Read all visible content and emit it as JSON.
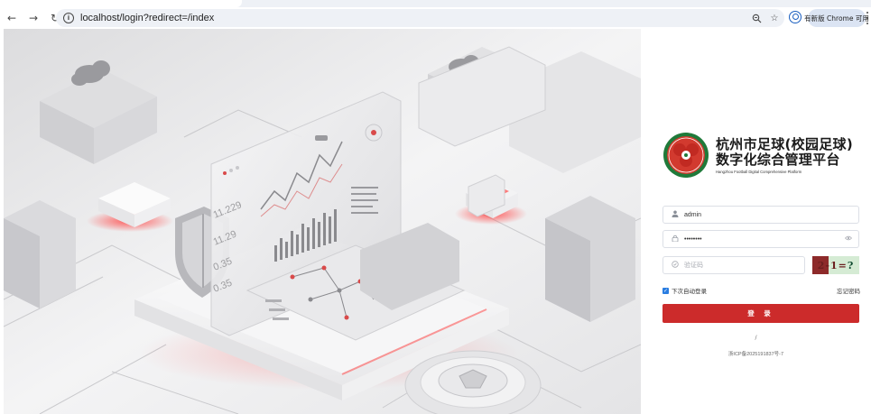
{
  "browser": {
    "url": "localhost/login?redirect=/index",
    "update_label": "有新版 Chrome 可用"
  },
  "brand": {
    "title_line1": "杭州市足球(校园足球)",
    "title_line2": "数字化综合管理平台",
    "subtitle": "Hangzhou Football Digital Comprehensive Platform",
    "accent_color": "#cc2b2b"
  },
  "hero": {
    "panel_values": [
      "11.229",
      "11.29",
      "0.35",
      "0.35"
    ]
  },
  "login": {
    "username_value": "admin",
    "password_value": "••••••••",
    "captcha_placeholder": "验证码",
    "captcha_text": "2-1=",
    "captcha_last": "?",
    "remember_label": "下次自动登录",
    "remember_checked": true,
    "forgot_label": "忘记密码",
    "submit_label": "登 录",
    "slash": "/",
    "icp": "浙ICP备2025191837号-7"
  },
  "icons": {
    "back": "arrow-left-icon",
    "forward": "arrow-right-icon",
    "reload": "reload-icon",
    "info": "info-icon",
    "zoom": "zoom-icon",
    "star": "star-icon",
    "profile": "profile-icon",
    "menu": "kebab-menu-icon",
    "user": "user-icon",
    "lock": "lock-icon",
    "eye": "eye-icon",
    "shield": "shield-icon"
  }
}
